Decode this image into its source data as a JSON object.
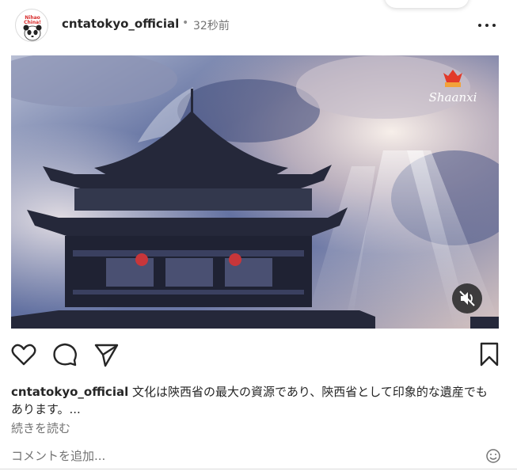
{
  "post": {
    "username": "cntatokyo_official",
    "separator": "•",
    "time": "32秒前",
    "more_icon": "more-horizontal-icon"
  },
  "avatar": {
    "logo_text": "Nihao China!"
  },
  "media": {
    "brand_logo_text": "Shaanxi",
    "brand_color": "#e23a2a",
    "mute_icon": "speaker-muted-icon"
  },
  "actions": {
    "like_icon": "heart-icon",
    "comment_icon": "comment-icon",
    "share_icon": "send-icon",
    "save_icon": "bookmark-icon"
  },
  "caption": {
    "username": "cntatokyo_official",
    "text": "文化は陝西省の最大の資源であり、陝西省として印象的な遺産でもあります。...",
    "read_more": "続きを読む"
  },
  "comment": {
    "placeholder": "コメントを追加...",
    "emoji_icon": "emoji-icon"
  }
}
